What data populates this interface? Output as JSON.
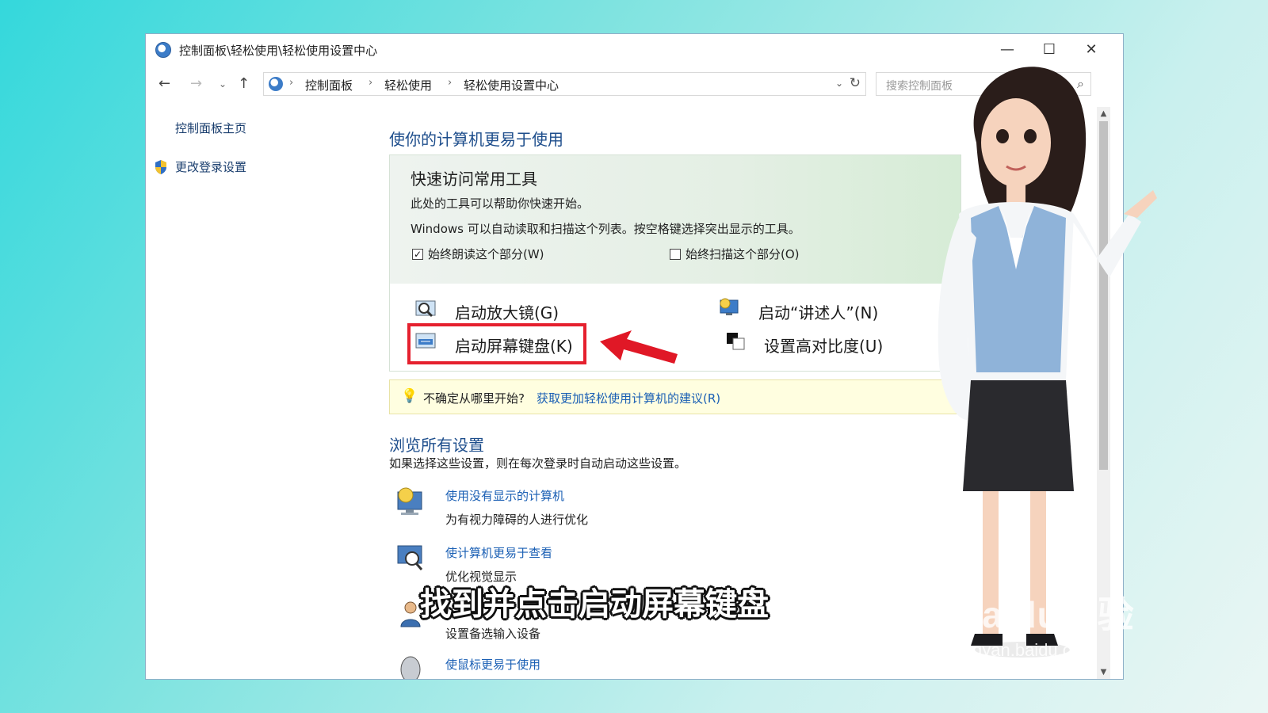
{
  "window": {
    "title": "控制面板\\轻松使用\\轻松使用设置中心",
    "controls": {
      "minimize": "—",
      "maximize": "☐",
      "close": "✕"
    }
  },
  "nav": {
    "back": "←",
    "forward": "→",
    "dropdown": "⌄",
    "up": "↑",
    "breadcrumb": [
      "控制面板",
      "轻松使用",
      "轻松使用设置中心"
    ],
    "separator": "›",
    "address_dropdown": "⌄",
    "refresh": "↻",
    "search_placeholder": "搜索控制面板",
    "search_icon": "⌕"
  },
  "sidebar": {
    "home_link": "控制面板主页",
    "login_settings": "更改登录设置"
  },
  "help_icon": "?",
  "scrollbar": {
    "up": "▲",
    "down": "▼"
  },
  "main": {
    "title": "使你的计算机更易于使用",
    "quick_access": {
      "title": "快速访问常用工具",
      "line1": "此处的工具可以帮助你快速开始。",
      "line2": "Windows 可以自动读取和扫描这个列表。按空格键选择突出显示的工具。",
      "always_read": {
        "label": "始终朗读这个部分(W)",
        "checked": true,
        "mark": "✓"
      },
      "always_scan": {
        "label": "始终扫描这个部分(O)",
        "checked": false,
        "mark": ""
      }
    },
    "tools": {
      "magnifier": "启动放大镜(G)",
      "narrator": "启动“讲述人”(N)",
      "onscreen_keyboard": "启动屏幕键盘(K)",
      "high_contrast": "设置高对比度(U)"
    },
    "tip": {
      "text": "不确定从哪里开始?",
      "link": "获取更加轻松使用计算机的建议(R)"
    },
    "browse": {
      "title": "浏览所有设置",
      "subtitle": "如果选择这些设置，则在每次登录时自动启动这些设置。",
      "items": [
        {
          "link": "使用没有显示的计算机",
          "desc": "为有视力障碍的人进行优化"
        },
        {
          "link": "使计算机更易于查看",
          "desc": "优化视觉显示"
        },
        {
          "link": "",
          "desc": "设置备选输入设备"
        },
        {
          "link": "使鼠标更易于使用",
          "desc": ""
        }
      ]
    }
  },
  "caption": "找到并点击启动屏幕键盘",
  "watermark": {
    "logo": "Baidu经验",
    "url": "jingyan.baidu.com"
  },
  "colors": {
    "highlight": "#e5202e",
    "link": "#1a5fb4",
    "heading": "#1e4e8c"
  }
}
